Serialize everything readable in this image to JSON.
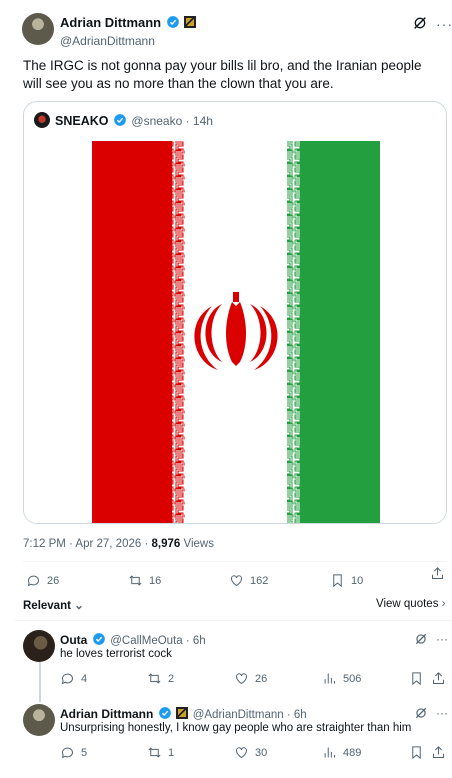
{
  "main_tweet": {
    "author_name": "Adrian Dittmann",
    "author_handle": "@AdrianDittmann",
    "text": "The IRGC is not gonna pay your bills lil bro, and the Iranian people will see you as no more than the clown that you are.",
    "timestamp": "7:12 PM · Apr 27, 2026 · ",
    "views_count": "8,976",
    "views_label": " Views",
    "replies": "26",
    "reposts": "16",
    "likes": "162",
    "bookmarks": "10"
  },
  "quoted_tweet": {
    "author_name": "SNEAKO",
    "author_handle": "@sneako · 14h",
    "image": "iran-flag"
  },
  "sort": {
    "label": "Relevant",
    "view_quotes": "View quotes"
  },
  "replies": [
    {
      "author_name": "Outa",
      "author_handle": "@CallMeOuta · 6h",
      "text": "he loves terrorist cock",
      "replies": "4",
      "reposts": "2",
      "likes": "26",
      "views": "506"
    },
    {
      "author_name": "Adrian Dittmann",
      "author_handle": "@AdrianDittmann · 6h",
      "text": "Unsurprising honestly, I know gay people who are straighter than him",
      "replies": "5",
      "reposts": "1",
      "likes": "30",
      "views": "489"
    }
  ],
  "colors": {
    "accent": "#1d9bf0",
    "flag_red": "#da0000",
    "flag_green": "#239f40"
  }
}
